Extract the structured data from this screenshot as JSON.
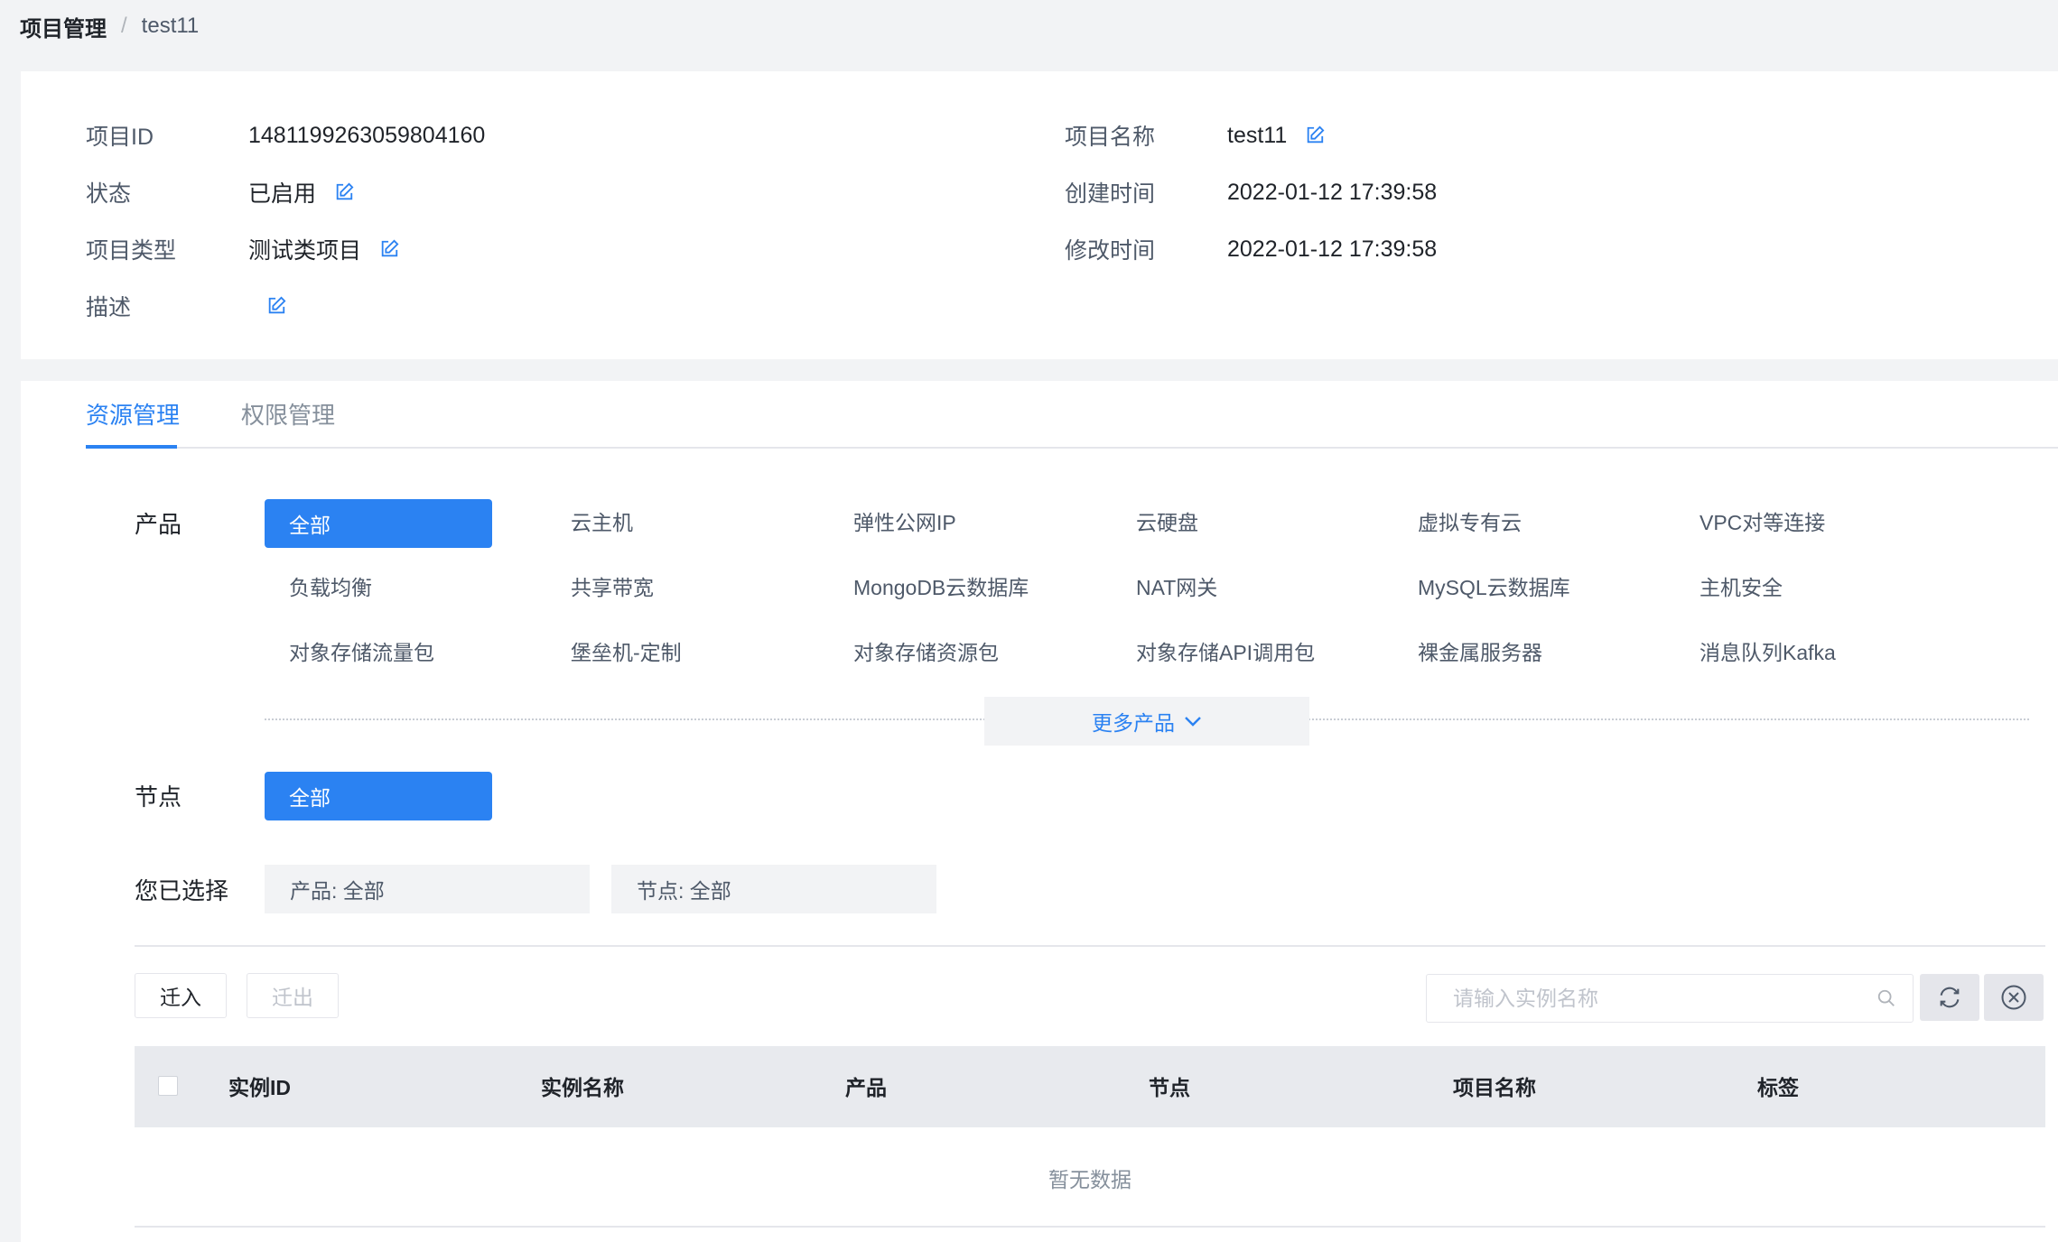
{
  "breadcrumb": {
    "root": "项目管理",
    "separator": "/",
    "current": "test11"
  },
  "info": {
    "project_id_label": "项目ID",
    "project_id_value": "1481199263059804160",
    "status_label": "状态",
    "status_value": "已启用",
    "type_label": "项目类型",
    "type_value": "测试类项目",
    "desc_label": "描述",
    "desc_value": "",
    "name_label": "项目名称",
    "name_value": "test11",
    "created_label": "创建时间",
    "created_value": "2022-01-12 17:39:58",
    "modified_label": "修改时间",
    "modified_value": "2022-01-12 17:39:58"
  },
  "tabs": [
    {
      "label": "资源管理",
      "active": true
    },
    {
      "label": "权限管理",
      "active": false
    }
  ],
  "filters": {
    "product_label": "产品",
    "products": [
      "全部",
      "云主机",
      "弹性公网IP",
      "云硬盘",
      "虚拟专有云",
      "VPC对等连接",
      "负载均衡",
      "共享带宽",
      "MongoDB云数据库",
      "NAT网关",
      "MySQL云数据库",
      "主机安全",
      "对象存储流量包",
      "堡垒机-定制",
      "对象存储资源包",
      "对象存储API调用包",
      "裸金属服务器",
      "消息队列Kafka"
    ],
    "selected_product": "全部",
    "more_label": "更多产品",
    "node_label": "节点",
    "node_selected": "全部",
    "chosen_label": "您已选择",
    "chosen": [
      "产品: 全部",
      "节点: 全部"
    ]
  },
  "toolbar": {
    "move_in": "迁入",
    "move_out": "迁出",
    "search_placeholder": "请输入实例名称"
  },
  "table": {
    "columns": [
      "实例ID",
      "实例名称",
      "产品",
      "节点",
      "项目名称",
      "标签"
    ],
    "empty_text": "暂无数据"
  },
  "colors": {
    "accent": "#2b82f2",
    "page_bg": "#f2f3f5",
    "header_bg": "#e8eaee"
  }
}
